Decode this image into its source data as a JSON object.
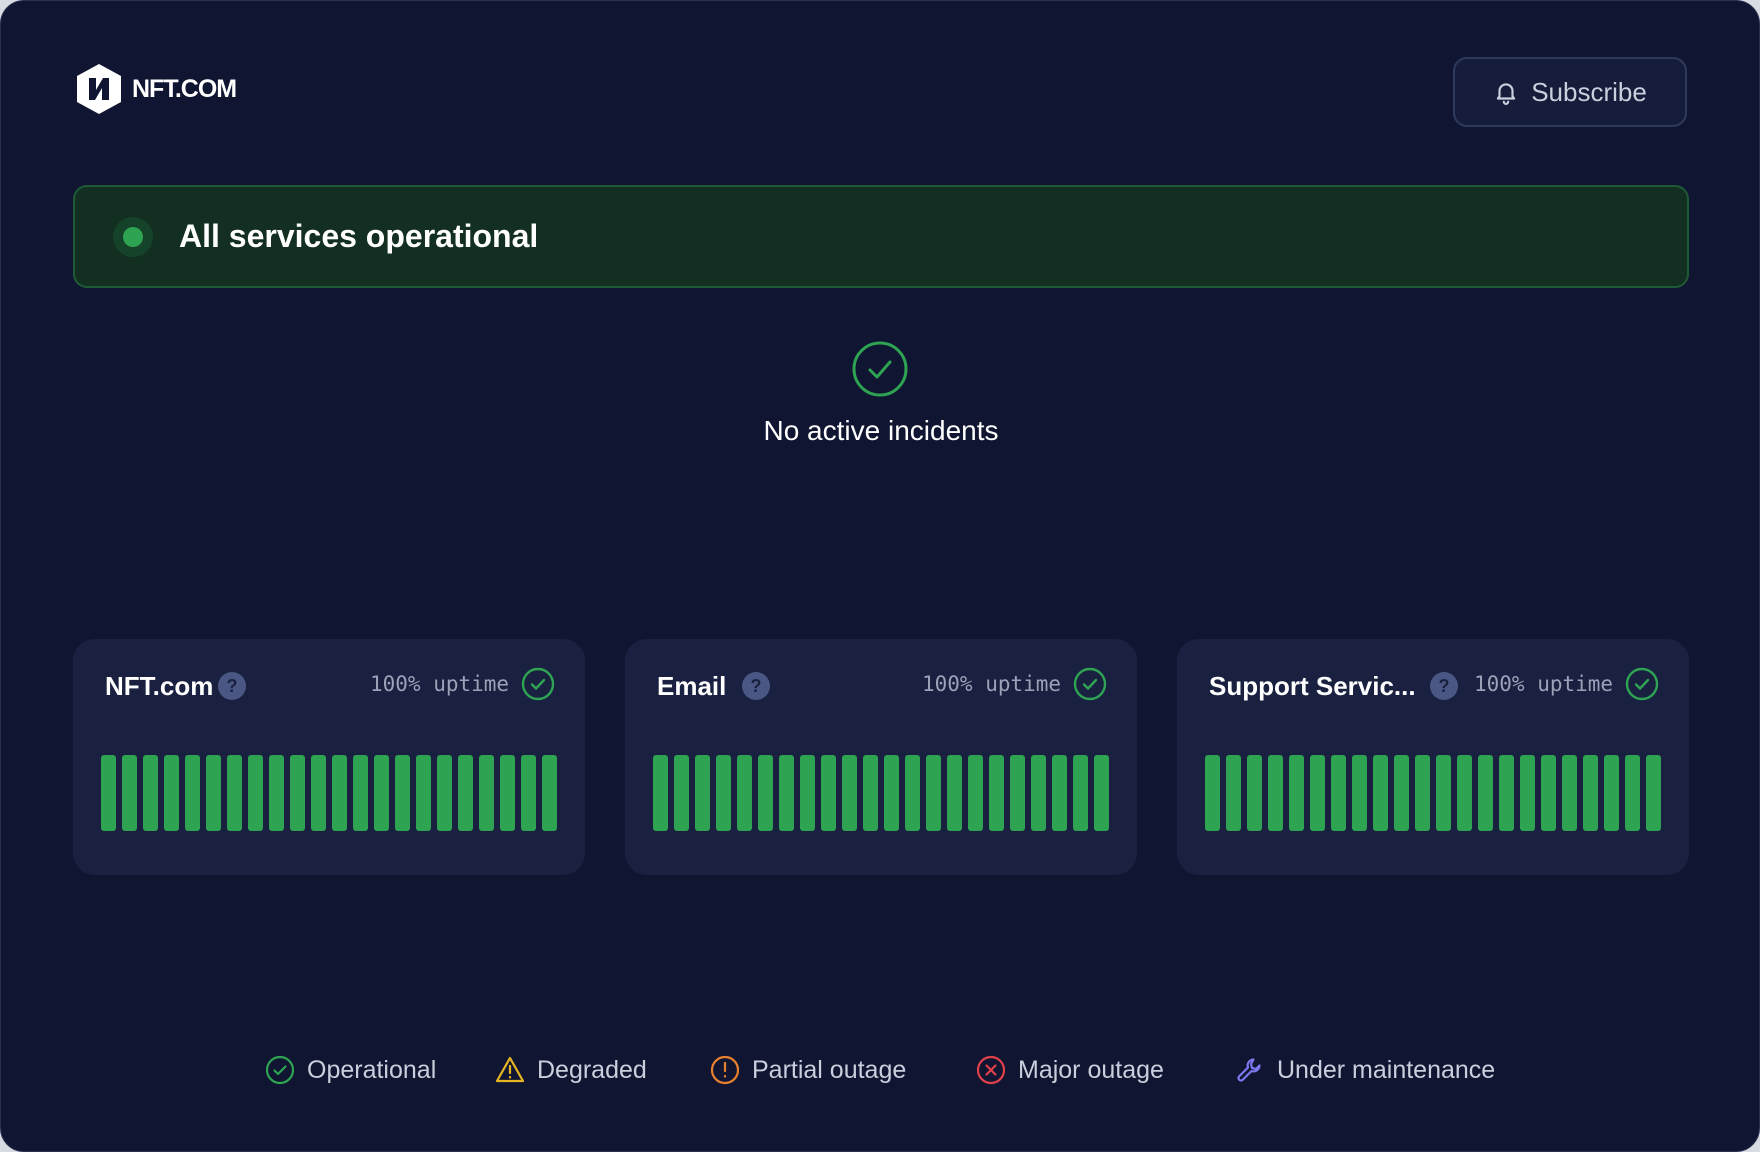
{
  "header": {
    "logo_text": "NFT.COM",
    "subscribe_label": "Subscribe"
  },
  "status_banner": {
    "text": "All services operational",
    "color": "#2ea352"
  },
  "incidents": {
    "text": "No active incidents"
  },
  "services": [
    {
      "name": "NFT.com",
      "uptime_label": "100% uptime",
      "status": "operational",
      "days": 22
    },
    {
      "name": "Email",
      "uptime_label": "100% uptime",
      "status": "operational",
      "days": 22
    },
    {
      "name": "Support Servic...",
      "uptime_label": "100% uptime",
      "status": "operational",
      "days": 22
    }
  ],
  "legend": [
    {
      "label": "Operational",
      "icon": "check-circle-icon",
      "color": "#2ea352"
    },
    {
      "label": "Degraded",
      "icon": "warning-triangle-icon",
      "color": "#e6b422"
    },
    {
      "label": "Partial outage",
      "icon": "exclamation-circle-icon",
      "color": "#e8812f"
    },
    {
      "label": "Major outage",
      "icon": "x-circle-icon",
      "color": "#e0404a"
    },
    {
      "label": "Under maintenance",
      "icon": "wrench-icon",
      "color": "#7b78f0"
    }
  ],
  "colors": {
    "background": "#101531",
    "card": "#1a2140",
    "operational": "#2ea352"
  }
}
